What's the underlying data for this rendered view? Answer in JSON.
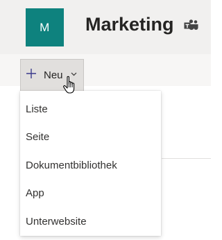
{
  "site": {
    "tile_letter": "M",
    "title": "Marketing",
    "accent_color": "#0e827e",
    "teams_icon": "teams-icon"
  },
  "toolbar": {
    "new_label": "Neu",
    "plus_icon": "plus-icon",
    "chevron_icon": "chevron-down-icon"
  },
  "new_menu": {
    "items": [
      {
        "label": "Liste"
      },
      {
        "label": "Seite"
      },
      {
        "label": "Dokumentbibliothek"
      },
      {
        "label": "App"
      },
      {
        "label": "Unterwebsite"
      }
    ]
  }
}
